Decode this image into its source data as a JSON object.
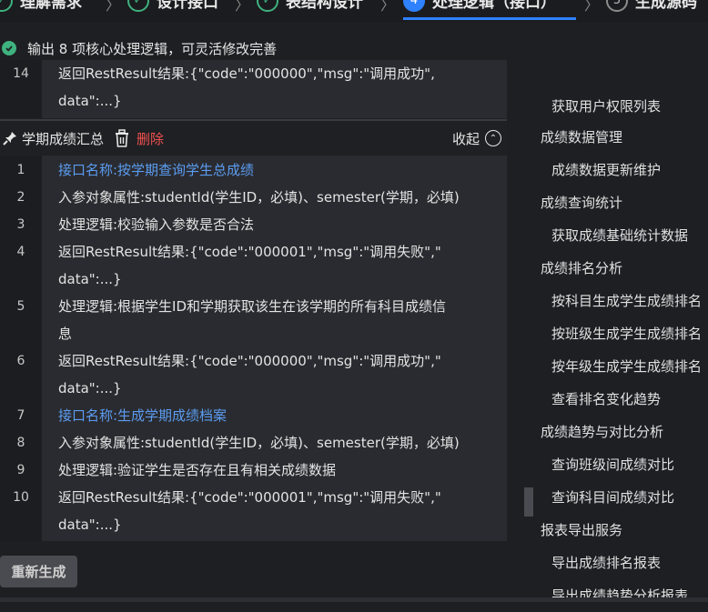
{
  "steps": [
    {
      "label": "理解需求",
      "state": "done"
    },
    {
      "label": "设计接口",
      "state": "done"
    },
    {
      "label": "表结构设计",
      "state": "done"
    },
    {
      "label": "处理逻辑（接口）",
      "state": "active",
      "number": "4"
    },
    {
      "label": "生成源码",
      "state": "todo",
      "number": "5"
    }
  ],
  "status": {
    "text": "输出 8 项核心处理逻辑，可灵活修改完善"
  },
  "top_block": {
    "lines": [
      {
        "num": "14",
        "text": "返回RestResult结果:{\"code\":\"000000\",\"msg\":\"调用成功\","
      },
      {
        "num": "",
        "text": "data\":...}"
      }
    ]
  },
  "section": {
    "title": "学期成绩汇总",
    "delete_label": "删除",
    "collapse_label": "收起"
  },
  "code_lines": [
    {
      "num": "1",
      "text": "接口名称:按学期查询学生总成绩",
      "type": "link"
    },
    {
      "num": "2",
      "text": "入参对象属性:studentId(学生ID，必填)、semester(学期，必填)",
      "type": "text"
    },
    {
      "num": "3",
      "text": "处理逻辑:校验输入参数是否合法",
      "type": "text"
    },
    {
      "num": "4",
      "text": "返回RestResult结果:{\"code\":\"000001\",\"msg\":\"调用失败\",\"",
      "type": "text"
    },
    {
      "num": "",
      "text": "data\":...}",
      "type": "text"
    },
    {
      "num": "5",
      "text": "处理逻辑:根据学生ID和学期获取该生在该学期的所有科目成绩信",
      "type": "text"
    },
    {
      "num": "",
      "text": "息",
      "type": "text"
    },
    {
      "num": "6",
      "text": "返回RestResult结果:{\"code\":\"000000\",\"msg\":\"调用成功\",\"",
      "type": "text"
    },
    {
      "num": "",
      "text": "data\":...}",
      "type": "text"
    },
    {
      "num": "7",
      "text": "接口名称:生成学期成绩档案",
      "type": "link"
    },
    {
      "num": "8",
      "text": "入参对象属性:studentId(学生ID，必填)、semester(学期，必填)",
      "type": "text"
    },
    {
      "num": "9",
      "text": "处理逻辑:验证学生是否存在且有相关成绩数据",
      "type": "text"
    },
    {
      "num": "10",
      "text": "返回RestResult结果:{\"code\":\"000001\",\"msg\":\"调用失败\",\"",
      "type": "text"
    },
    {
      "num": "",
      "text": "data\":...}",
      "type": "text"
    }
  ],
  "tree": [
    {
      "label": "获取用户权限列表",
      "level": 2
    },
    {
      "label": "成绩数据管理",
      "level": 1
    },
    {
      "label": "成绩数据更新维护",
      "level": 2
    },
    {
      "label": "成绩查询统计",
      "level": 1
    },
    {
      "label": "获取成绩基础统计数据",
      "level": 2
    },
    {
      "label": "成绩排名分析",
      "level": 1
    },
    {
      "label": "按科目生成学生成绩排名",
      "level": 2
    },
    {
      "label": "按班级生成学生成绩排名",
      "level": 2
    },
    {
      "label": "按年级生成学生成绩排名",
      "level": 2
    },
    {
      "label": "查看排名变化趋势",
      "level": 2
    },
    {
      "label": "成绩趋势与对比分析",
      "level": 1
    },
    {
      "label": "查询班级间成绩对比",
      "level": 2
    },
    {
      "label": "查询科目间成绩对比",
      "level": 2
    },
    {
      "label": "报表导出服务",
      "level": 1
    },
    {
      "label": "导出成绩排名报表",
      "level": 2
    },
    {
      "label": "导出成绩趋势分析报表",
      "level": 2
    }
  ],
  "regenerate_label": "重新生成",
  "colors": {
    "accent": "#2f81ff",
    "success": "#3fb27f",
    "danger": "#f0504f",
    "link": "#5b9cf0"
  }
}
